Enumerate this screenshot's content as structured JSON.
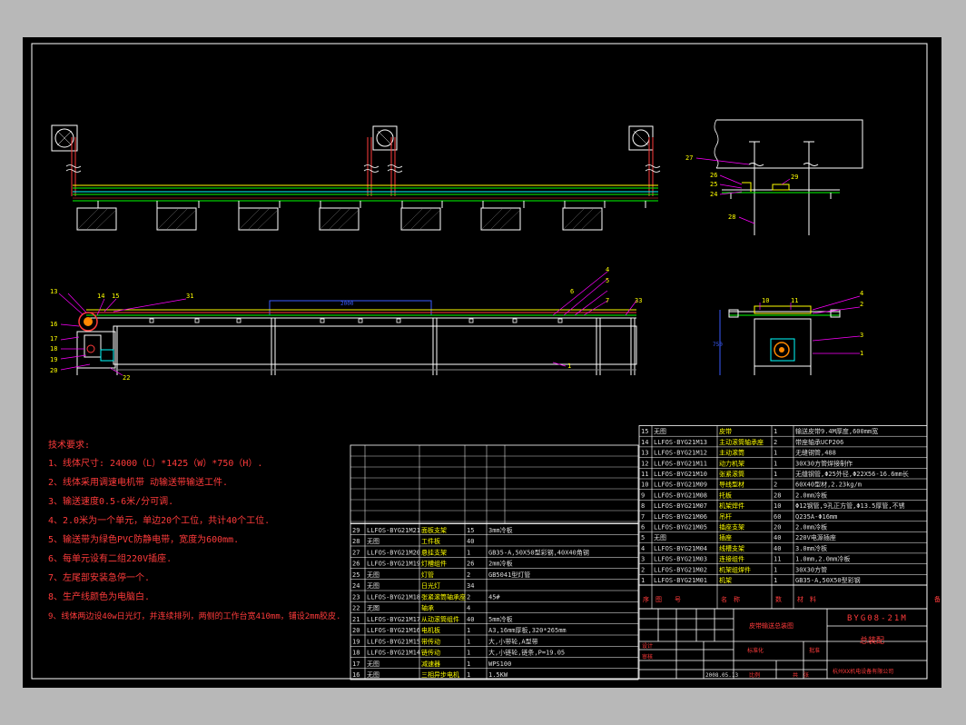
{
  "tech_requirements": {
    "title": "技术要求:",
    "lines": [
      "1、线体尺寸: 24000（L）*1425（W）*750（H）.",
      "2、线体采用调速电机带 动输送带输送工件.",
      "3、输送速度0.5-6米/分可调.",
      "4、2.0米为一个单元，单边20个工位，共计40个工位.",
      "5、输送带为绿色PVC防静电带，宽度为600mm.",
      "6、每单元设有二组220V插座.",
      "7、左尾部安装急停一个.",
      "8、生产线颜色为电脑白.",
      "9、线体两边设40w日光灯，并连续排列，两侧的工作台宽410mm，铺设2mm胶皮."
    ]
  },
  "dimension_2000": "2000",
  "side_dimension": "750",
  "part_numbers_top": [
    "27",
    "26",
    "25",
    "24",
    "29",
    "28"
  ],
  "part_numbers_mid": [
    "13",
    "14",
    "15",
    "31",
    "16",
    "17",
    "18",
    "19",
    "20",
    "22",
    "1",
    "4",
    "5",
    "6",
    "7",
    "33"
  ],
  "part_numbers_right": [
    "10",
    "11",
    "4",
    "2",
    "3",
    "1"
  ],
  "bom_right": [
    {
      "no": "15",
      "code": "无图",
      "name": "皮带",
      "qty": "1",
      "spec": "输送皮带9.4M厚度,600mm宽"
    },
    {
      "no": "14",
      "code": "LLFOS-BYG21M13",
      "name": "主动滚筒轴承座",
      "qty": "2",
      "spec": "带座轴承UCP206"
    },
    {
      "no": "13",
      "code": "LLFOS-BYG21M12",
      "name": "主动滚筒",
      "qty": "1",
      "spec": "无缝钢管,488"
    },
    {
      "no": "12",
      "code": "LLFOS-BYG21M11",
      "name": "动力机架",
      "qty": "1",
      "spec": "30X30方管焊接制作"
    },
    {
      "no": "11",
      "code": "LLFOS-BYG21M10",
      "name": "张紧滚筒",
      "qty": "1",
      "spec": "无缝钢管,Φ25外径,Φ22X56-16.6mm长"
    },
    {
      "no": "10",
      "code": "LLFOS-BYG21M09",
      "name": "导线型材",
      "qty": "2",
      "spec": "60X40型材,2.23kg/m"
    },
    {
      "no": "9",
      "code": "LLFOS-BYG21M08",
      "name": "托板",
      "qty": "28",
      "spec": "2.0mm冷板"
    },
    {
      "no": "8",
      "code": "LLFOS-BYG21M07",
      "name": "机架焊件",
      "qty": "10",
      "spec": "Φ12钢管,9孔正方管,Φ13.5厚管,不锈"
    },
    {
      "no": "7",
      "code": "LLFOS-BYG21M06",
      "name": "吊杆",
      "qty": "60",
      "spec": "Q235A-Φ16mm"
    },
    {
      "no": "6",
      "code": "LLFOS-BYG21M05",
      "name": "插座支架",
      "qty": "20",
      "spec": "2.0mm冷板"
    },
    {
      "no": "5",
      "code": "无图",
      "name": "插座",
      "qty": "40",
      "spec": "220V电源插座"
    },
    {
      "no": "4",
      "code": "LLFOS-BYG21M04",
      "name": "线槽支架",
      "qty": "40",
      "spec": "3.0mm冷板"
    },
    {
      "no": "3",
      "code": "LLFOS-BYG21M03",
      "name": "连接组件",
      "qty": "11",
      "spec": "1.0mm,2.0mm冷板"
    },
    {
      "no": "2",
      "code": "LLFOS-BYG21M02",
      "name": "机架组焊件",
      "qty": "1",
      "spec": "30X30方管"
    },
    {
      "no": "1",
      "code": "LLFOS-BYG21M01",
      "name": "机架",
      "qty": "1",
      "spec": "GB35-A,50X50型彩钢"
    }
  ],
  "bom_right_header": {
    "no": "序",
    "code": "图　　号",
    "name": "名　称",
    "qty": "数",
    "material": "材　料",
    "remark": "备 注"
  },
  "bom_left": [
    {
      "no": "29",
      "code": "LLFOS-BYG21M21",
      "name": "面板支架",
      "qty": "15",
      "spec": "3mm冷板"
    },
    {
      "no": "28",
      "code": "无图",
      "name": "工件板",
      "qty": "40",
      "spec": ""
    },
    {
      "no": "27",
      "code": "LLFOS-BYG21M20",
      "name": "悬挂支架",
      "qty": "1",
      "spec": "GB35-A,50X50型彩钢,40X40角钢"
    },
    {
      "no": "26",
      "code": "LLFOS-BYG21M19",
      "name": "灯槽组件",
      "qty": "26",
      "spec": "2mm冷板"
    },
    {
      "no": "25",
      "code": "无图",
      "name": "灯管",
      "qty": "2",
      "spec": "GB5041型灯管"
    },
    {
      "no": "24",
      "code": "无图",
      "name": "日光灯",
      "qty": "34",
      "spec": ""
    },
    {
      "no": "23",
      "code": "LLFOS-BYG21M18",
      "name": "张紧滚筒轴承座",
      "qty": "2",
      "spec": "45#"
    },
    {
      "no": "22",
      "code": "无图",
      "name": "轴承",
      "qty": "4",
      "spec": ""
    },
    {
      "no": "21",
      "code": "LLFOS-BYG21M17",
      "name": "从动滚筒组件",
      "qty": "40",
      "spec": "5mm冷板"
    },
    {
      "no": "20",
      "code": "LLFOS-BYG21M16",
      "name": "电机板",
      "qty": "1",
      "spec": "A3,16mm厚板,320*265mm"
    },
    {
      "no": "19",
      "code": "LLFOS-BYG21M15",
      "name": "带传动",
      "qty": "1",
      "spec": "大,小带轮,A型带"
    },
    {
      "no": "18",
      "code": "LLFOS-BYG21M14",
      "name": "链传动",
      "qty": "1",
      "spec": "大,小链轮,链条,P=19.05"
    },
    {
      "no": "17",
      "code": "无图",
      "name": "减速器",
      "qty": "1",
      "spec": "WPS100"
    },
    {
      "no": "16",
      "code": "无图",
      "name": "三相异步电机",
      "qty": "1",
      "spec": "1.5KW"
    }
  ],
  "title_block": {
    "project": "皮带输送总装图",
    "drawing_no": "BYG08-21M",
    "drawing_name": "总装配",
    "company": "杭州XX机电设备有限公司",
    "date": "2008.05.13",
    "scale_label": "比例",
    "sheet_label": "共　张",
    "design": "设计",
    "check": "审核",
    "approve": "批准",
    "standard": "标准化"
  },
  "colors": {
    "background": "#000000",
    "frame": "#ffffff",
    "conveyor_green": "#00ff00",
    "conveyor_yellow": "#ffff00",
    "leader": "#ff00ff",
    "red_text": "#ff3b3b",
    "blue": "#3a5cff",
    "cyan": "#00ffff"
  }
}
